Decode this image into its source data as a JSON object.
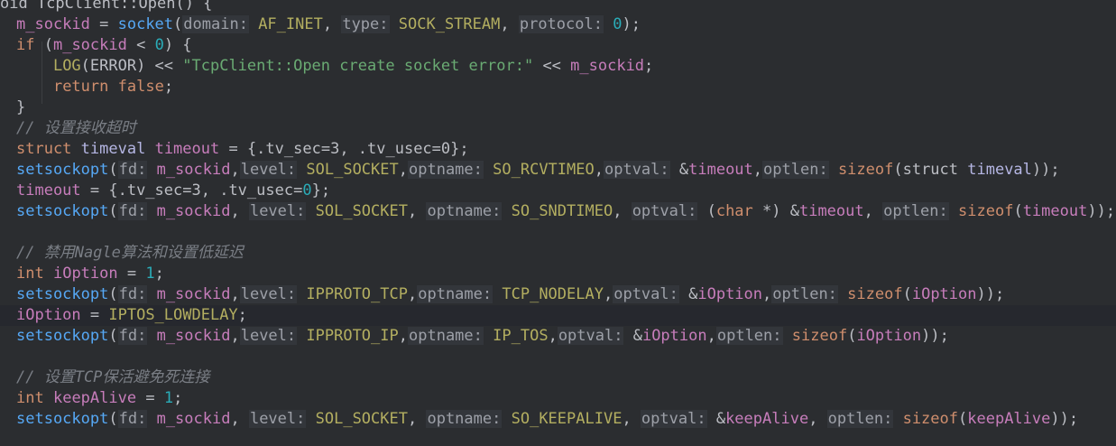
{
  "colors": {
    "background": "#2b2d30",
    "variable": "#c77dbb",
    "function": "#56a8f5",
    "keyword": "#cf8e6d",
    "number": "#2aacb8",
    "string": "#6aab73",
    "comment": "#7a7e85",
    "macro": "#b3ae60",
    "type": "#b5b6e3",
    "parameter_hint": "#9da0a8",
    "text": "#bcbec4"
  },
  "lines": [
    {
      "tokens": [
        [
          "plain",
          "oid TcpClient::Open() "
        ],
        [
          "plain",
          "{"
        ]
      ]
    },
    {
      "tokens": [
        [
          "var",
          "m_sockid"
        ],
        [
          "plain",
          " = "
        ],
        [
          "fn",
          "socket"
        ],
        [
          "plain",
          "("
        ],
        [
          "hint",
          "domain:"
        ],
        [
          "plain",
          " "
        ],
        [
          "macro",
          "AF_INET"
        ],
        [
          "plain",
          ", "
        ],
        [
          "hint",
          "type:"
        ],
        [
          "plain",
          " "
        ],
        [
          "macro",
          "SOCK_STREAM"
        ],
        [
          "plain",
          ", "
        ],
        [
          "hint",
          "protocol:"
        ],
        [
          "plain",
          " "
        ],
        [
          "num",
          "0"
        ],
        [
          "plain",
          ");"
        ]
      ]
    },
    {
      "tokens": [
        [
          "kw",
          "if"
        ],
        [
          "plain",
          " ("
        ],
        [
          "var",
          "m_sockid"
        ],
        [
          "plain",
          " < "
        ],
        [
          "num",
          "0"
        ],
        [
          "plain",
          ") {"
        ]
      ]
    },
    {
      "tokens": [
        [
          "plain",
          "    "
        ],
        [
          "macro",
          "LOG"
        ],
        [
          "plain",
          "(ERROR) << "
        ],
        [
          "str",
          "\"TcpClient::Open create socket error:\""
        ],
        [
          "plain",
          " << "
        ],
        [
          "var",
          "m_sockid"
        ],
        [
          "plain",
          ";"
        ]
      ]
    },
    {
      "tokens": [
        [
          "plain",
          "    "
        ],
        [
          "kw",
          "return"
        ],
        [
          "plain",
          " "
        ],
        [
          "kw",
          "false"
        ],
        [
          "plain",
          ";"
        ]
      ]
    },
    {
      "tokens": [
        [
          "plain",
          "}"
        ]
      ]
    },
    {
      "tokens": [
        [
          "cmt",
          "// 设置接收超时"
        ]
      ]
    },
    {
      "tokens": [
        [
          "kw",
          "struct"
        ],
        [
          "plain",
          " "
        ],
        [
          "type",
          "timeval"
        ],
        [
          "plain",
          " "
        ],
        [
          "var",
          "timeout"
        ],
        [
          "plain",
          " = {.tv_sec="
        ],
        [
          "plain",
          "3"
        ],
        [
          "plain",
          ", .tv_usec="
        ],
        [
          "plain",
          "0"
        ],
        [
          "plain",
          "};"
        ]
      ]
    },
    {
      "tokens": [
        [
          "fn",
          "setsockopt"
        ],
        [
          "plain",
          "("
        ],
        [
          "hint",
          "fd:"
        ],
        [
          "plain",
          " "
        ],
        [
          "var",
          "m_sockid"
        ],
        [
          "plain",
          ","
        ],
        [
          "hint",
          "level:"
        ],
        [
          "plain",
          " "
        ],
        [
          "macro",
          "SOL_SOCKET"
        ],
        [
          "plain",
          ","
        ],
        [
          "hint",
          "optname:"
        ],
        [
          "plain",
          " "
        ],
        [
          "macro",
          "SO_RCVTIMEO"
        ],
        [
          "plain",
          ","
        ],
        [
          "hint",
          "optval:"
        ],
        [
          "plain",
          " &"
        ],
        [
          "var",
          "timeout"
        ],
        [
          "plain",
          ","
        ],
        [
          "hint",
          "optlen:"
        ],
        [
          "plain",
          " "
        ],
        [
          "kw",
          "sizeof"
        ],
        [
          "plain",
          "(struct "
        ],
        [
          "type",
          "timeval"
        ],
        [
          "plain",
          "));"
        ]
      ]
    },
    {
      "tokens": [
        [
          "var",
          "timeout"
        ],
        [
          "plain",
          " = {.tv_sec="
        ],
        [
          "plain",
          "3"
        ],
        [
          "plain",
          ", .tv_usec="
        ],
        [
          "num",
          "0"
        ],
        [
          "plain",
          "};"
        ]
      ]
    },
    {
      "tokens": [
        [
          "fn",
          "setsockopt"
        ],
        [
          "plain",
          "("
        ],
        [
          "hint",
          "fd:"
        ],
        [
          "plain",
          " "
        ],
        [
          "var",
          "m_sockid"
        ],
        [
          "plain",
          ", "
        ],
        [
          "hint",
          "level:"
        ],
        [
          "plain",
          " "
        ],
        [
          "macro",
          "SOL_SOCKET"
        ],
        [
          "plain",
          ", "
        ],
        [
          "hint",
          "optname:"
        ],
        [
          "plain",
          " "
        ],
        [
          "macro",
          "SO_SNDTIMEO"
        ],
        [
          "plain",
          ", "
        ],
        [
          "hint",
          "optval:"
        ],
        [
          "plain",
          " ("
        ],
        [
          "kw",
          "char"
        ],
        [
          "plain",
          " *) &"
        ],
        [
          "var",
          "timeout"
        ],
        [
          "plain",
          ", "
        ],
        [
          "hint",
          "optlen:"
        ],
        [
          "plain",
          " "
        ],
        [
          "kw",
          "sizeof"
        ],
        [
          "plain",
          "("
        ],
        [
          "var",
          "timeout"
        ],
        [
          "plain",
          "));"
        ]
      ]
    },
    {
      "tokens": []
    },
    {
      "tokens": [
        [
          "cmt",
          "// 禁用Nagle算法和设置低延迟"
        ]
      ]
    },
    {
      "tokens": [
        [
          "kw",
          "int"
        ],
        [
          "plain",
          " "
        ],
        [
          "var",
          "iOption"
        ],
        [
          "plain",
          " = "
        ],
        [
          "num",
          "1"
        ],
        [
          "plain",
          ";"
        ]
      ]
    },
    {
      "tokens": [
        [
          "fn",
          "setsockopt"
        ],
        [
          "plain",
          "("
        ],
        [
          "hint",
          "fd:"
        ],
        [
          "plain",
          " "
        ],
        [
          "var",
          "m_sockid"
        ],
        [
          "plain",
          ","
        ],
        [
          "hint",
          "level:"
        ],
        [
          "plain",
          " "
        ],
        [
          "macro",
          "IPPROTO_TCP"
        ],
        [
          "plain",
          ","
        ],
        [
          "hint",
          "optname:"
        ],
        [
          "plain",
          " "
        ],
        [
          "macro",
          "TCP_NODELAY"
        ],
        [
          "plain",
          ","
        ],
        [
          "hint",
          "optval:"
        ],
        [
          "plain",
          " &"
        ],
        [
          "var",
          "iOption"
        ],
        [
          "plain",
          ","
        ],
        [
          "hint",
          "optlen:"
        ],
        [
          "plain",
          " "
        ],
        [
          "kw",
          "sizeof"
        ],
        [
          "plain",
          "("
        ],
        [
          "var",
          "iOption"
        ],
        [
          "plain",
          "));"
        ]
      ]
    },
    {
      "tokens": [
        [
          "var",
          "iOption"
        ],
        [
          "plain",
          " = "
        ],
        [
          "macro",
          "IPTOS_LOWDELAY"
        ],
        [
          "plain",
          ";"
        ]
      ]
    },
    {
      "tokens": [
        [
          "fn",
          "setsockopt"
        ],
        [
          "plain",
          "("
        ],
        [
          "hint",
          "fd:"
        ],
        [
          "plain",
          " "
        ],
        [
          "var",
          "m_sockid"
        ],
        [
          "plain",
          ","
        ],
        [
          "hint",
          "level:"
        ],
        [
          "plain",
          " "
        ],
        [
          "macro",
          "IPPROTO_IP"
        ],
        [
          "plain",
          ","
        ],
        [
          "hint",
          "optname:"
        ],
        [
          "plain",
          " "
        ],
        [
          "macro",
          "IP_TOS"
        ],
        [
          "plain",
          ","
        ],
        [
          "hint",
          "optval:"
        ],
        [
          "plain",
          " &"
        ],
        [
          "var",
          "iOption"
        ],
        [
          "plain",
          ","
        ],
        [
          "hint",
          "optlen:"
        ],
        [
          "plain",
          " "
        ],
        [
          "kw",
          "sizeof"
        ],
        [
          "plain",
          "("
        ],
        [
          "var",
          "iOption"
        ],
        [
          "plain",
          "));"
        ]
      ]
    },
    {
      "tokens": []
    },
    {
      "tokens": [
        [
          "cmt",
          "// 设置TCP保活避免死连接"
        ]
      ]
    },
    {
      "tokens": [
        [
          "kw",
          "int"
        ],
        [
          "plain",
          " "
        ],
        [
          "var",
          "keepAlive"
        ],
        [
          "plain",
          " = "
        ],
        [
          "num",
          "1"
        ],
        [
          "plain",
          ";"
        ]
      ]
    },
    {
      "tokens": [
        [
          "fn",
          "setsockopt"
        ],
        [
          "plain",
          "("
        ],
        [
          "hint",
          "fd:"
        ],
        [
          "plain",
          " "
        ],
        [
          "var",
          "m_sockid"
        ],
        [
          "plain",
          ", "
        ],
        [
          "hint",
          "level:"
        ],
        [
          "plain",
          " "
        ],
        [
          "macro",
          "SOL_SOCKET"
        ],
        [
          "plain",
          ", "
        ],
        [
          "hint",
          "optname:"
        ],
        [
          "plain",
          " "
        ],
        [
          "macro",
          "SO_KEEPALIVE"
        ],
        [
          "plain",
          ", "
        ],
        [
          "hint",
          "optval:"
        ],
        [
          "plain",
          " &"
        ],
        [
          "var",
          "keepAlive"
        ],
        [
          "plain",
          ", "
        ],
        [
          "hint",
          "optlen:"
        ],
        [
          "plain",
          " "
        ],
        [
          "kw",
          "sizeof"
        ],
        [
          "plain",
          "("
        ],
        [
          "var",
          "keepAlive"
        ],
        [
          "plain",
          "));"
        ]
      ]
    }
  ]
}
